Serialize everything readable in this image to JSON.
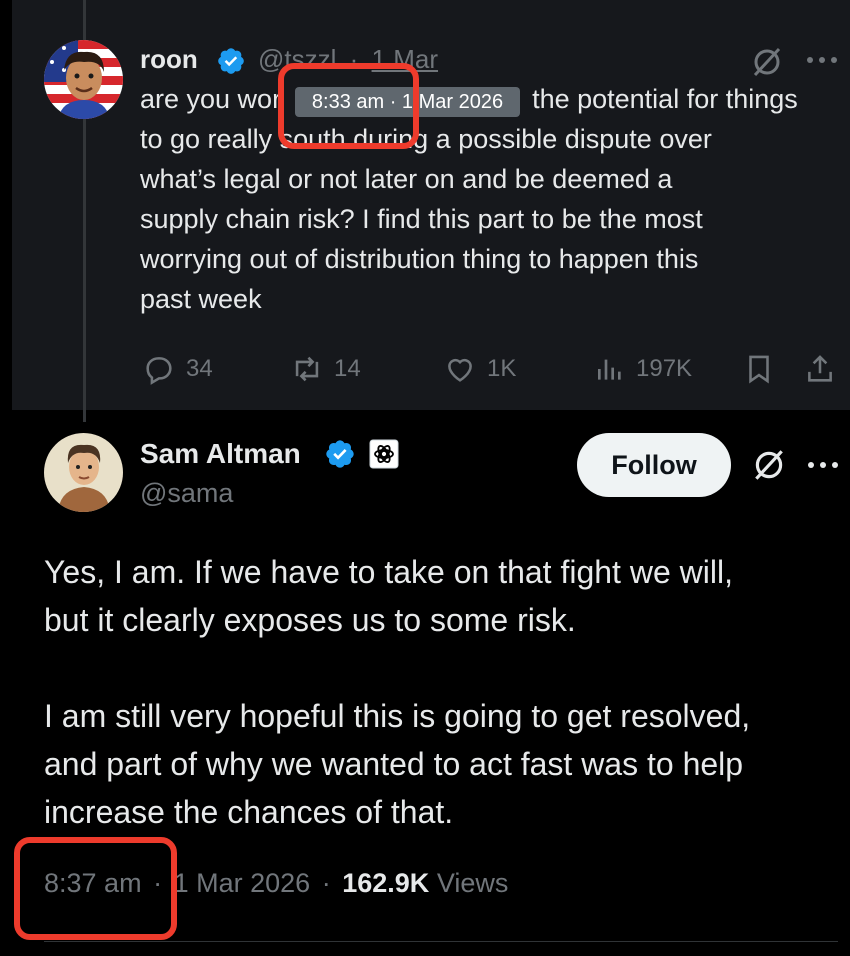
{
  "reply_tweet": {
    "name": "roon",
    "handle": "@tszzl",
    "separator": "·",
    "date": "1 Mar",
    "tooltip": "8:33 am · 1 Mar 2026",
    "text_lines": [
      "are you wor",
      "the potential for things",
      "to go really south during a possible dispute over",
      "what’s legal or not later on and be deemed a",
      "supply chain risk? I find this part to be the most",
      "worrying out of distribution thing to happen this",
      "past week"
    ],
    "actions": {
      "replies": "34",
      "reposts": "14",
      "likes": "1K",
      "views": "197K"
    }
  },
  "main_tweet": {
    "name": "Sam Altman",
    "handle": "@sama",
    "follow_label": "Follow",
    "paragraphs": [
      [
        "Yes, I am. If we have to take on that fight we will,",
        "but it clearly exposes us to some risk."
      ],
      [
        "I am still very hopeful this is going to get resolved,",
        "and part of why we wanted to act fast was to help",
        "increase the chances of that."
      ]
    ],
    "time": "8:37 am",
    "separator": "·",
    "date": "1 Mar 2026",
    "views_count": "162.9K",
    "views_label": "Views"
  },
  "colors": {
    "background": "#000000",
    "reply_background": "#16181c",
    "text": "#e7e9ea",
    "muted": "#71767b",
    "verified": "#1d9bf0",
    "highlight_box": "#ee3b2c",
    "follow_button": "#eff3f4"
  },
  "icons": [
    "verified-badge-icon",
    "grok-slash-icon",
    "more-icon",
    "reply-icon",
    "repost-icon",
    "like-icon",
    "views-icon",
    "bookmark-icon",
    "share-icon",
    "openai-logo-icon"
  ]
}
